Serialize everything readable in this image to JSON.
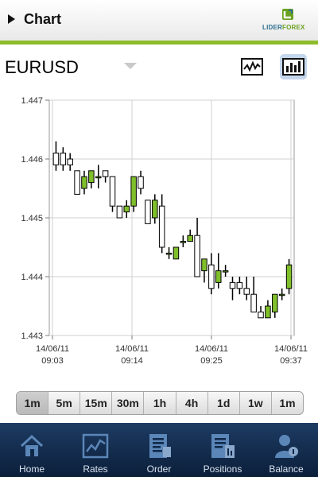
{
  "header": {
    "title": "Chart",
    "back_icon": "play-arrow-icon"
  },
  "logo": {
    "text_main": "LIDER",
    "text_accent": "FOREX"
  },
  "symbol": {
    "name": "EURUSD"
  },
  "chart_type_buttons": [
    {
      "name": "line-chart-icon",
      "selected": false
    },
    {
      "name": "bar-chart-icon",
      "selected": true
    }
  ],
  "chart_data": {
    "type": "candlestick",
    "ylim": [
      1.443,
      1.447
    ],
    "yticks": [
      "1.443",
      "1.444",
      "1.445",
      "1.446",
      "1.447"
    ],
    "xticks": [
      {
        "date": "14/06/11",
        "time": "09:03"
      },
      {
        "date": "14/06/11",
        "time": "09:14"
      },
      {
        "date": "14/06/11",
        "time": "09:25"
      },
      {
        "date": "14/06/11",
        "time": "09:37"
      }
    ],
    "grid": true,
    "up_color": "#7fbf2a",
    "down_color": "#ffffff",
    "candles": [
      {
        "o": 1.4461,
        "h": 1.4463,
        "l": 1.4458,
        "c": 1.4459
      },
      {
        "o": 1.4461,
        "h": 1.4462,
        "l": 1.4458,
        "c": 1.4459
      },
      {
        "o": 1.446,
        "h": 1.4461,
        "l": 1.4458,
        "c": 1.4459
      },
      {
        "o": 1.4458,
        "h": 1.4458,
        "l": 1.4454,
        "c": 1.4454
      },
      {
        "o": 1.4455,
        "h": 1.4458,
        "l": 1.4454,
        "c": 1.4457
      },
      {
        "o": 1.4456,
        "h": 1.4458,
        "l": 1.4455,
        "c": 1.4458
      },
      {
        "o": 1.4457,
        "h": 1.4459,
        "l": 1.4455,
        "c": 1.4457
      },
      {
        "o": 1.4458,
        "h": 1.4458,
        "l": 1.4456,
        "c": 1.4457
      },
      {
        "o": 1.4457,
        "h": 1.4457,
        "l": 1.4451,
        "c": 1.4452
      },
      {
        "o": 1.4452,
        "h": 1.4452,
        "l": 1.445,
        "c": 1.445
      },
      {
        "o": 1.4451,
        "h": 1.4453,
        "l": 1.445,
        "c": 1.4452
      },
      {
        "o": 1.4452,
        "h": 1.4457,
        "l": 1.4451,
        "c": 1.4457
      },
      {
        "o": 1.4457,
        "h": 1.4458,
        "l": 1.4454,
        "c": 1.4455
      },
      {
        "o": 1.4453,
        "h": 1.4453,
        "l": 1.4449,
        "c": 1.4449
      },
      {
        "o": 1.445,
        "h": 1.4454,
        "l": 1.4449,
        "c": 1.4453
      },
      {
        "o": 1.4452,
        "h": 1.4454,
        "l": 1.4444,
        "c": 1.4445
      },
      {
        "o": 1.4444,
        "h": 1.4445,
        "l": 1.4443,
        "c": 1.4444
      },
      {
        "o": 1.4443,
        "h": 1.4445,
        "l": 1.4443,
        "c": 1.4445
      },
      {
        "o": 1.4446,
        "h": 1.4447,
        "l": 1.4445,
        "c": 1.4446
      },
      {
        "o": 1.4446,
        "h": 1.4448,
        "l": 1.4446,
        "c": 1.4447
      },
      {
        "o": 1.4447,
        "h": 1.445,
        "l": 1.444,
        "c": 1.444
      },
      {
        "o": 1.4441,
        "h": 1.4443,
        "l": 1.4439,
        "c": 1.4443
      },
      {
        "o": 1.4442,
        "h": 1.4444,
        "l": 1.4437,
        "c": 1.4438
      },
      {
        "o": 1.4439,
        "h": 1.4444,
        "l": 1.4438,
        "c": 1.4441
      },
      {
        "o": 1.4441,
        "h": 1.4442,
        "l": 1.444,
        "c": 1.4441
      },
      {
        "o": 1.4439,
        "h": 1.444,
        "l": 1.4436,
        "c": 1.4438
      },
      {
        "o": 1.4439,
        "h": 1.444,
        "l": 1.4437,
        "c": 1.4438
      },
      {
        "o": 1.4438,
        "h": 1.444,
        "l": 1.4436,
        "c": 1.4437
      },
      {
        "o": 1.4437,
        "h": 1.444,
        "l": 1.4435,
        "c": 1.4434
      },
      {
        "o": 1.4434,
        "h": 1.4435,
        "l": 1.4433,
        "c": 1.4433
      },
      {
        "o": 1.4433,
        "h": 1.4436,
        "l": 1.4433,
        "c": 1.4435
      },
      {
        "o": 1.4434,
        "h": 1.4437,
        "l": 1.4433,
        "c": 1.4437
      },
      {
        "o": 1.4437,
        "h": 1.4438,
        "l": 1.4436,
        "c": 1.4437
      },
      {
        "o": 1.4438,
        "h": 1.4443,
        "l": 1.4437,
        "c": 1.4442
      }
    ]
  },
  "timeframes": [
    {
      "label": "1m",
      "active": true
    },
    {
      "label": "5m",
      "active": false
    },
    {
      "label": "15m",
      "active": false
    },
    {
      "label": "30m",
      "active": false
    },
    {
      "label": "1h",
      "active": false
    },
    {
      "label": "4h",
      "active": false
    },
    {
      "label": "1d",
      "active": false
    },
    {
      "label": "1w",
      "active": false
    },
    {
      "label": "1m",
      "active": false
    }
  ],
  "nav": [
    {
      "label": "Home",
      "icon": "home-icon"
    },
    {
      "label": "Rates",
      "icon": "rates-chart-icon"
    },
    {
      "label": "Order",
      "icon": "order-document-icon"
    },
    {
      "label": "Positions",
      "icon": "positions-document-icon"
    },
    {
      "label": "Balance",
      "icon": "balance-user-icon"
    }
  ]
}
